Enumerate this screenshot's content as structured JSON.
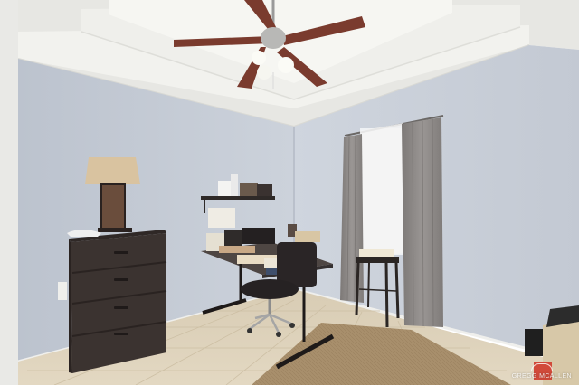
{
  "photo": {
    "watermark_text": "GREGG MCALLEN"
  },
  "colors": {
    "wall": "#c7ced8",
    "wall_shadow": "#b9c0cb",
    "ceiling": "#eeeeea",
    "tile_floor": "#dccfb6",
    "rug": "#a88f6c",
    "dresser": "#3b3330",
    "desk_top": "#4e4643",
    "curtain": "#8e8a88",
    "ceiling_fan_blade": "#7a3b2e"
  }
}
